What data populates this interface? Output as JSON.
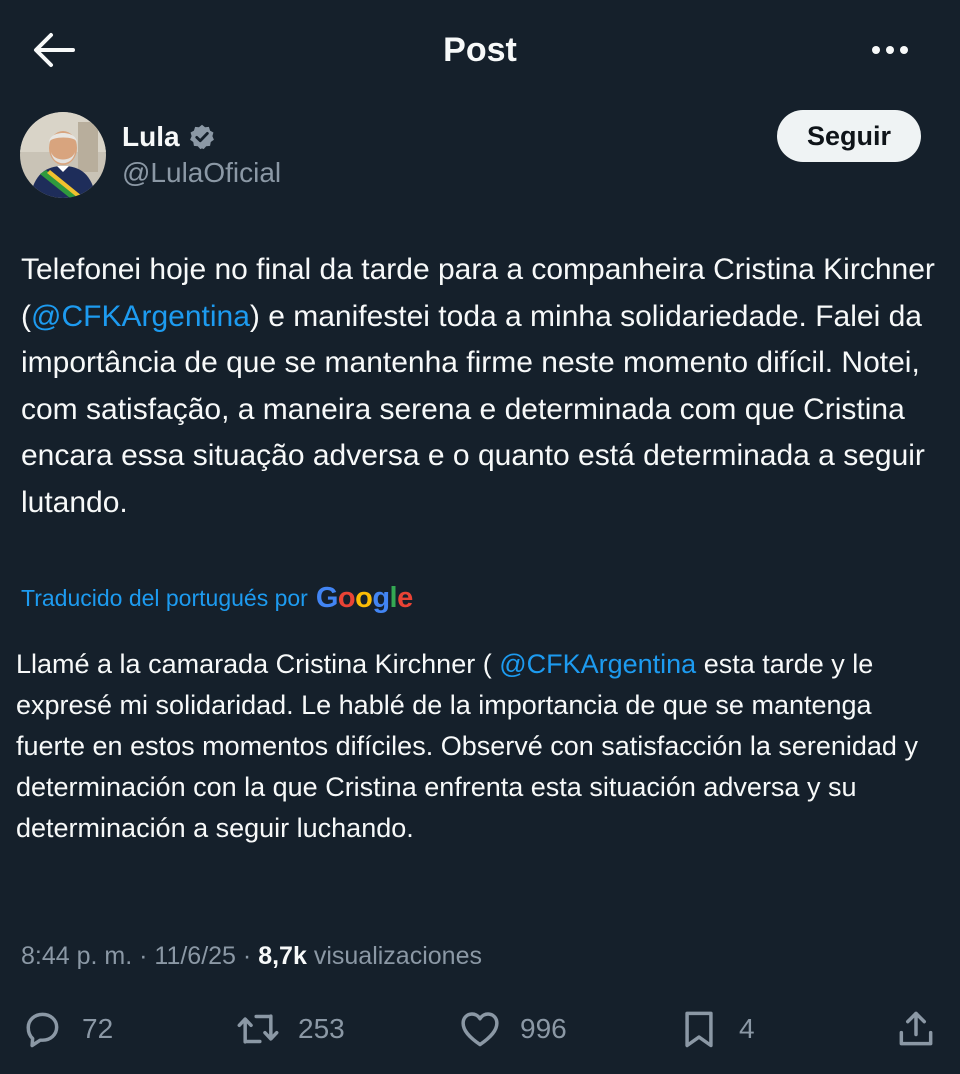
{
  "header": {
    "title": "Post"
  },
  "author": {
    "name": "Lula",
    "handle": "@LulaOficial",
    "follow_label": "Seguir"
  },
  "post": {
    "text_before": "Telefonei hoje no final da tarde para a companheira Cristina Kirchner (",
    "mention": "@CFKArgentina",
    "text_after": ") e manifestei toda a minha solidariedade. Falei da importância de que se mantenha firme neste momento difícil. Notei, com satisfação, a maneira serena e determinada com que Cristina encara essa situação adversa e o quanto está determinada a seguir lutando."
  },
  "translation": {
    "label": "Traducido del portugués por",
    "provider": "Google",
    "text_before": "Llamé a la camarada Cristina Kirchner ( ",
    "mention": "@CFKArgentina",
    "text_after": " esta tarde y le expresé mi solidaridad. Le hablé de la importancia de que se mantenga fuerte en estos momentos difíciles. Observé con satisfacción la serenidad y determinación con la que Cristina enfrenta esta situación adversa y su determinación a seguir luchando."
  },
  "meta": {
    "time": "8:44 p. m.",
    "date": "11/6/25",
    "views": "8,7k",
    "views_label": "visualizaciones"
  },
  "actions": {
    "replies": "72",
    "reposts": "253",
    "likes": "996",
    "bookmarks": "4"
  },
  "colors": {
    "background": "#15202b",
    "text": "#f7f9f9",
    "secondary": "#8b98a5",
    "accent": "#1d9bf0"
  },
  "icons": {
    "back": "arrow-left-icon",
    "more": "more-horizontal-icon",
    "verified": "verified-badge-icon",
    "reply": "reply-icon",
    "repost": "repost-icon",
    "like": "heart-icon",
    "bookmark": "bookmark-icon",
    "share": "share-icon"
  }
}
